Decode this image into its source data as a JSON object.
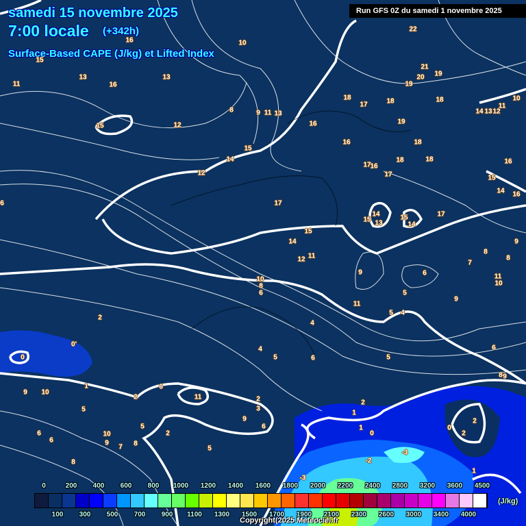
{
  "header": {
    "date": "samedi 15 novembre 2025",
    "time": "7:00 locale",
    "lead": "(+342h)",
    "subtitle": "Surface-Based CAPE (J/kg) et Lifted Index",
    "run": "Run GFS 0Z du samedi 1 novembre 2025"
  },
  "legend": {
    "colors": [
      "#0e1a3e",
      "#0a2f63",
      "#0a3590",
      "#0000c8",
      "#0000ff",
      "#0a3cff",
      "#0096ff",
      "#33c8ff",
      "#66ffff",
      "#66ff99",
      "#66ff66",
      "#66ff00",
      "#c8f000",
      "#ffff00",
      "#ffff80",
      "#ffe650",
      "#ffc800",
      "#ff9600",
      "#ff6400",
      "#ff3232",
      "#ff3200",
      "#ff0000",
      "#e60000",
      "#b40000",
      "#a0003c",
      "#aa006e",
      "#aa00aa",
      "#c800c8",
      "#e600e6",
      "#ff00ff",
      "#e678e6",
      "#ffc8ff",
      "#ffffff"
    ],
    "top_ticks": [
      "0",
      "200",
      "400",
      "600",
      "800",
      "1000",
      "1200",
      "1400",
      "1600",
      "1800",
      "2000",
      "2200",
      "2400",
      "2800",
      "3200",
      "3600",
      "4500"
    ],
    "bottom_ticks": [
      "100",
      "300",
      "500",
      "700",
      "900",
      "1100",
      "1300",
      "1500",
      "1700",
      "1900",
      "2100",
      "2300",
      "2600",
      "3000",
      "3400",
      "4000"
    ],
    "unit": "(J/kg)"
  },
  "copyright": "Copyright(2025 Meteociel.fr",
  "map": {
    "labels": [
      "22",
      "21",
      "20",
      "19",
      "19",
      "18",
      "17",
      "18",
      "18",
      "19",
      "16",
      "16",
      "18",
      "18",
      "18",
      "17",
      "16",
      "17",
      "16",
      "15",
      "14",
      "16",
      "14",
      "13",
      "12",
      "11",
      "10",
      "17",
      "15",
      "14",
      "13",
      "15",
      "14",
      "17",
      "15",
      "14",
      "12",
      "11",
      "10",
      "9",
      "8",
      "6",
      "7",
      "8",
      "8",
      "9",
      "11",
      "10",
      "9",
      "6",
      "5",
      "5",
      "4",
      "11",
      "4",
      "4",
      "5",
      "6",
      "5",
      "6",
      "8",
      "9",
      "2",
      "0'",
      "0",
      "1",
      "10",
      "9",
      "5",
      "6",
      "6",
      "10",
      "9",
      "7",
      "8",
      "8",
      "2",
      "6",
      "11",
      "2",
      "3",
      "9",
      "6",
      "5",
      "2",
      "5",
      "2",
      "1",
      "1",
      "0",
      "0",
      "2",
      "2",
      "-2",
      "-3",
      "-3",
      "1",
      "10",
      "16",
      "15",
      "13",
      "16",
      "13",
      "11",
      "15",
      "12",
      "8",
      "9",
      "11",
      "13",
      "15",
      "14",
      "12",
      "6"
    ]
  }
}
